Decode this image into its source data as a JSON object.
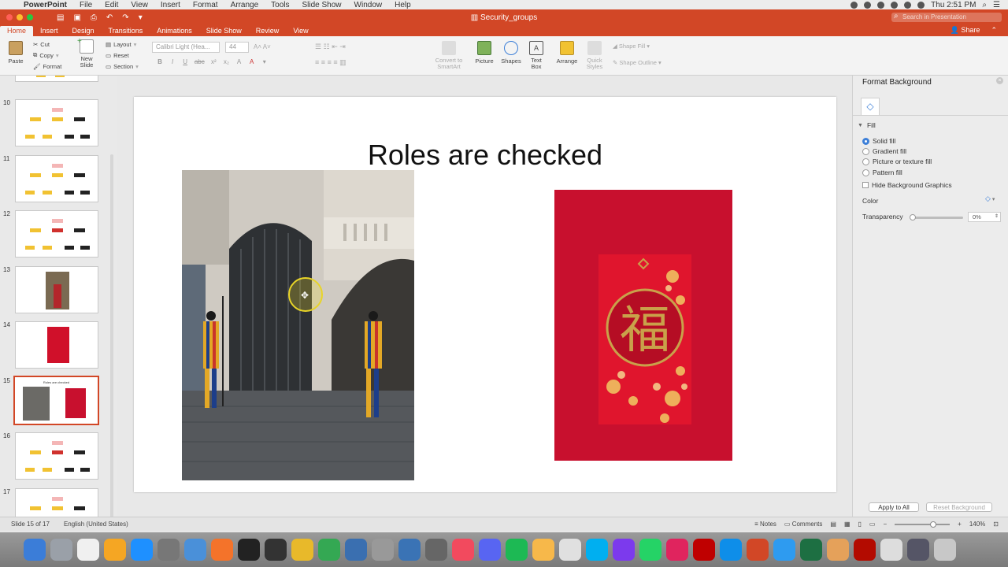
{
  "menubar": {
    "app_name": "PowerPoint",
    "items": [
      "File",
      "Edit",
      "View",
      "Insert",
      "Format",
      "Arrange",
      "Tools",
      "Slide Show",
      "Window",
      "Help"
    ],
    "clock": "Thu 2:51 PM"
  },
  "titlebar": {
    "doc_title": "Security_groups",
    "search_placeholder": "Search in Presentation"
  },
  "tabs": {
    "items": [
      "Home",
      "Insert",
      "Design",
      "Transitions",
      "Animations",
      "Slide Show",
      "Review",
      "View"
    ],
    "active": "Home",
    "share_label": "Share"
  },
  "ribbon": {
    "paste": "Paste",
    "cut": "Cut",
    "copy": "Copy",
    "format": "Format",
    "new_slide": "New Slide",
    "layout": "Layout",
    "reset": "Reset",
    "section": "Section",
    "font_name": "Calibri Light (Hea...",
    "font_size": "44",
    "bold": "B",
    "italic": "I",
    "underline": "U",
    "strikethrough": "abc",
    "convert_smartart": "Convert to SmartArt",
    "picture": "Picture",
    "shapes": "Shapes",
    "text_box": "Text Box",
    "arrange": "Arrange",
    "quick_styles": "Quick Styles",
    "shape_fill": "Shape Fill",
    "shape_outline": "Shape Outline"
  },
  "thumbnails": [
    {
      "num": "10",
      "kind": "diagram"
    },
    {
      "num": "11",
      "kind": "diagram"
    },
    {
      "num": "12",
      "kind": "diagram-red"
    },
    {
      "num": "13",
      "kind": "photo"
    },
    {
      "num": "14",
      "kind": "red"
    },
    {
      "num": "15",
      "kind": "current",
      "title": "Roles are checked"
    },
    {
      "num": "16",
      "kind": "diagram-red"
    },
    {
      "num": "17",
      "kind": "diagram"
    }
  ],
  "slide": {
    "title": "Roles are checked"
  },
  "format_pane": {
    "title": "Format Background",
    "section": "Fill",
    "options": [
      "Solid fill",
      "Gradient fill",
      "Picture or texture fill",
      "Pattern fill"
    ],
    "selected_option": "Solid fill",
    "hide_graphics": "Hide Background Graphics",
    "color_label": "Color",
    "transparency_label": "Transparency",
    "transparency_value": "0%",
    "apply_all": "Apply to All",
    "reset_background": "Reset Background"
  },
  "statusbar": {
    "slide_info": "Slide 15 of 17",
    "language": "English (United States)",
    "notes": "Notes",
    "comments": "Comments",
    "zoom": "140%"
  },
  "colors": {
    "accent": "#d24726",
    "selection": "#d24726",
    "envelope_red": "#c8102e"
  },
  "dock": [
    "finder",
    "safari",
    "calendar",
    "reeder",
    "app-store",
    "system-preferences",
    "xcode",
    "sublime",
    "terminal",
    "activity",
    "chrome",
    "drive",
    "ftp",
    "help",
    "sequel",
    "clock",
    "itunes",
    "discord",
    "spotify",
    "photos",
    "preview",
    "skype",
    "phpstorm",
    "whatsapp",
    "airmail",
    "filezilla",
    "teamviewer",
    "powerpoint",
    "messages",
    "excel",
    "java",
    "acrobat",
    "finder-window",
    "screen",
    "trash"
  ]
}
